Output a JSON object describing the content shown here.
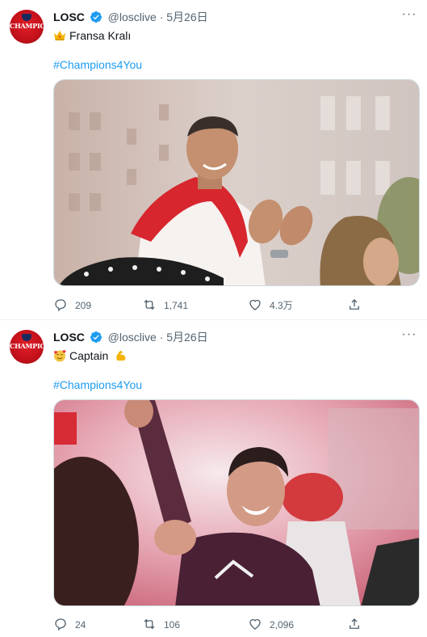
{
  "tweets": [
    {
      "author_name": "LOSC",
      "handle": "@losclive",
      "separator": "·",
      "date": "5月26日",
      "avatar_text": "CHAMPIONS",
      "text": "Fransa Kralı",
      "text_emoji": "crown-emoji",
      "hashtag": "#Champions4You",
      "image_alt": "Player in white shirt and red scarf clapping during street celebration",
      "reply_count": "209",
      "retweet_count": "1,741",
      "like_count": "4.3万"
    },
    {
      "author_name": "LOSC",
      "handle": "@losclive",
      "separator": "·",
      "date": "5月26日",
      "avatar_text": "CHAMPIONS",
      "text": "Captain",
      "text_emoji": "smiling-hearts-emoji",
      "trailing_emoji": "flexed-biceps-emoji",
      "hashtag": "#Champions4You",
      "image_alt": "Captain smiling and raising fist amid red flare smoke",
      "reply_count": "24",
      "retweet_count": "106",
      "like_count": "2,096"
    }
  ],
  "icons": {
    "reply": "reply-icon",
    "retweet": "retweet-icon",
    "like": "heart-icon",
    "share": "share-icon",
    "more": "more-icon",
    "verified": "verified-badge-icon"
  },
  "colors": {
    "link": "#1d9bf0",
    "secondary_text": "#536471",
    "verified": "#1d9bf0",
    "avatar_red": "#c3101a"
  }
}
